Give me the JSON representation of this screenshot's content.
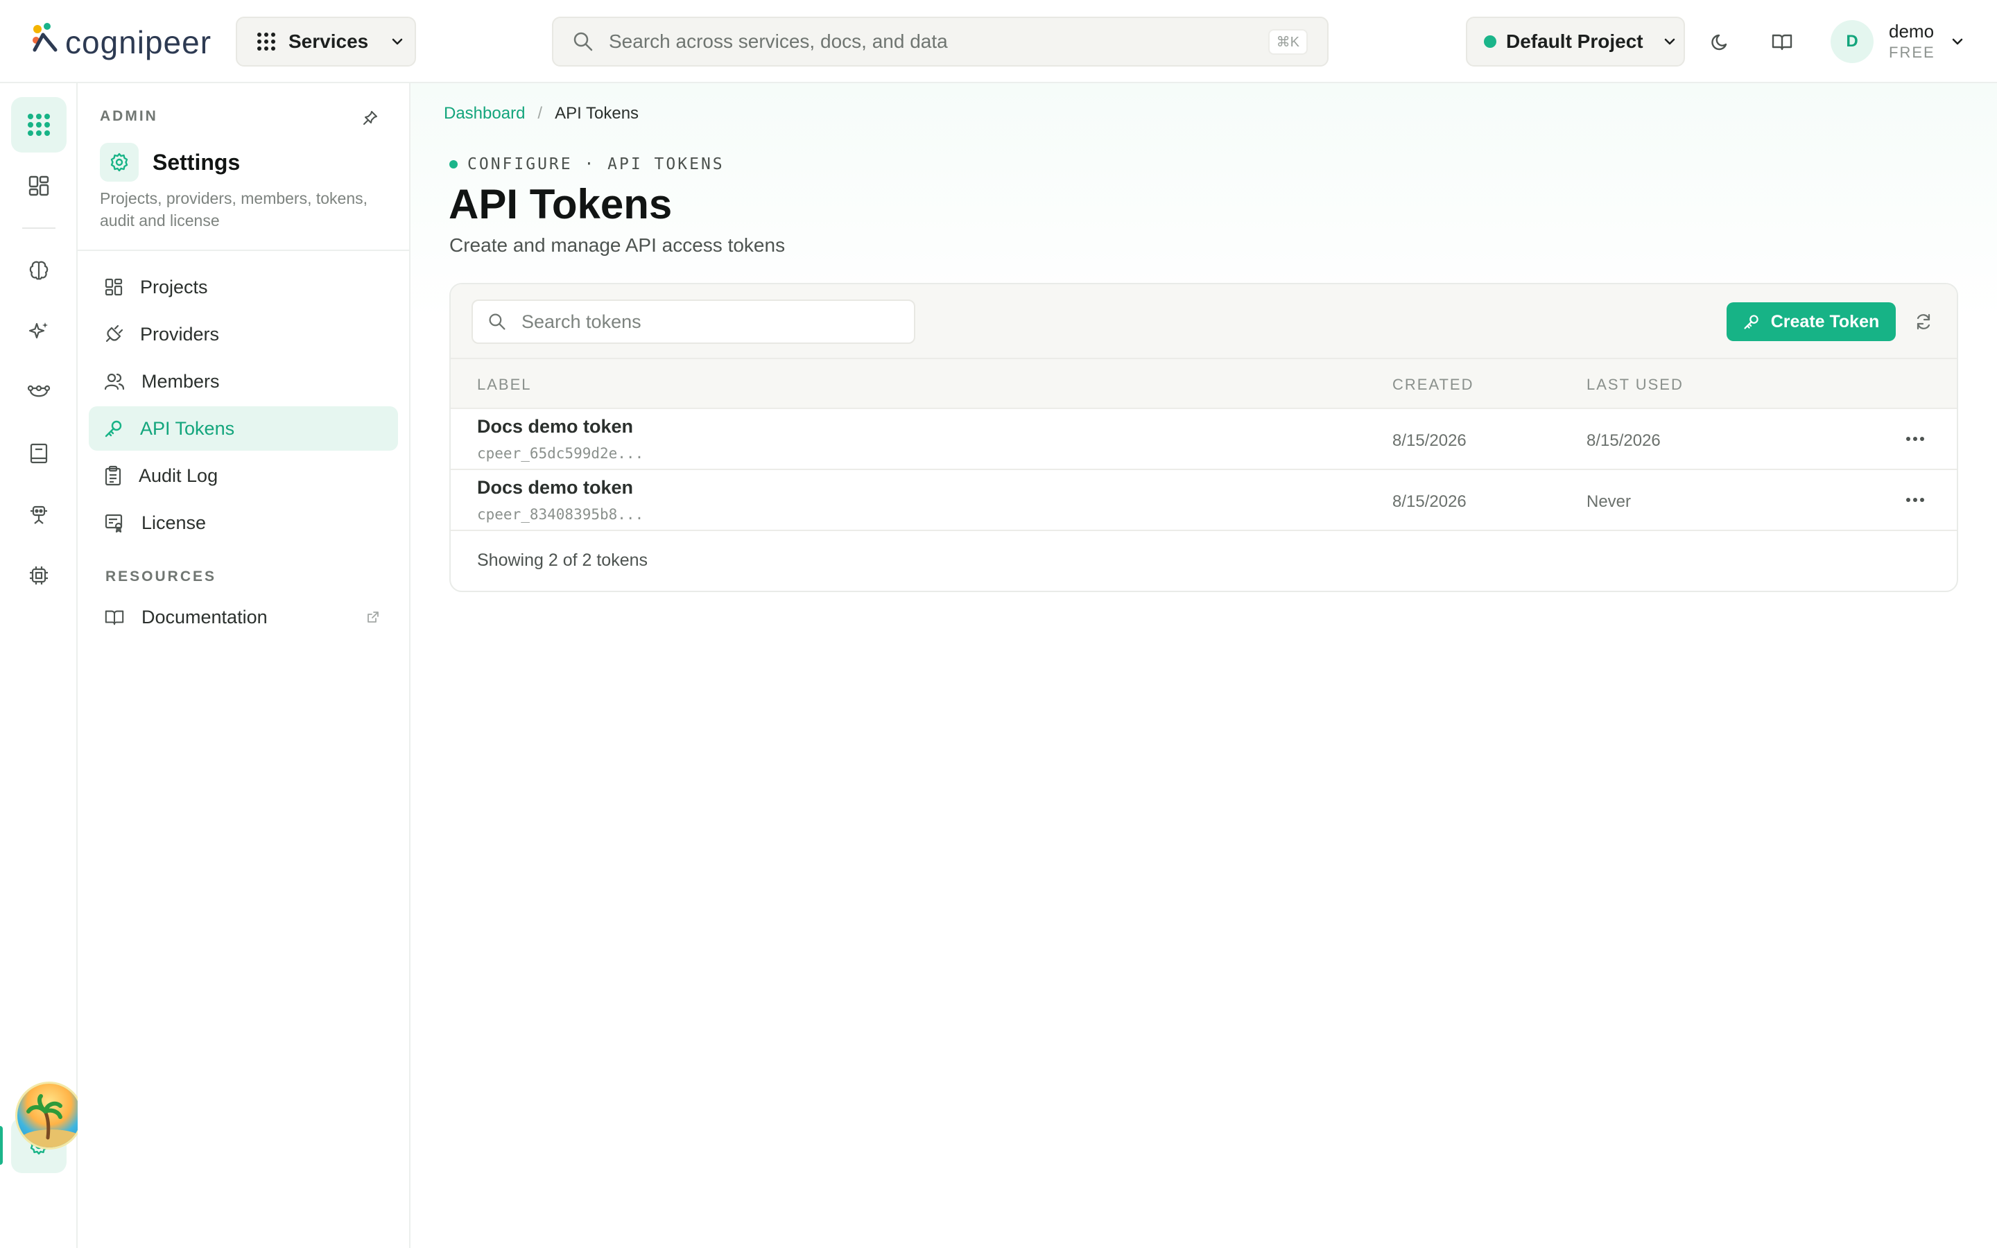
{
  "app": {
    "logo_text": "cognipeer",
    "services_label": "Services",
    "search_placeholder": "Search across services, docs, and data",
    "search_shortcut": "⌘K",
    "project_label": "Default Project",
    "user_initial": "D",
    "user_name": "demo",
    "user_plan": "FREE"
  },
  "rail": {
    "items": [
      "apps-grid-icon",
      "dashboard-icon",
      "brain-icon",
      "sparkles-icon",
      "flow-icon",
      "book-icon",
      "agent-icon",
      "chip-icon",
      "settings-icon"
    ]
  },
  "panel": {
    "section_label": "ADMIN",
    "title": "Settings",
    "description": "Projects, providers, members, tokens, audit and license",
    "nav": [
      {
        "label": "Projects",
        "icon": "projects-icon"
      },
      {
        "label": "Providers",
        "icon": "plug-icon"
      },
      {
        "label": "Members",
        "icon": "members-icon"
      },
      {
        "label": "API Tokens",
        "icon": "key-icon",
        "active": true
      },
      {
        "label": "Audit Log",
        "icon": "clipboard-icon"
      },
      {
        "label": "License",
        "icon": "license-icon"
      }
    ],
    "resources_label": "RESOURCES",
    "resources": [
      {
        "label": "Documentation",
        "icon": "book-open-icon"
      }
    ]
  },
  "main": {
    "breadcrumb": {
      "root": "Dashboard",
      "sep": "/",
      "current": "API Tokens"
    },
    "eyebrow": "CONFIGURE · API TOKENS",
    "title": "API Tokens",
    "subtitle": "Create and manage API access tokens",
    "search_placeholder": "Search tokens",
    "create_button": "Create Token",
    "columns": {
      "label": "LABEL",
      "created": "CREATED",
      "last_used": "LAST USED"
    },
    "tokens": [
      {
        "label": "Docs demo token",
        "key": "cpeer_65dc599d2e...",
        "created": "8/15/2026",
        "last_used": "8/15/2026"
      },
      {
        "label": "Docs demo token",
        "key": "cpeer_83408395b8...",
        "created": "8/15/2026",
        "last_used": "Never"
      }
    ],
    "footer": "Showing 2 of 2 tokens"
  },
  "colors": {
    "accent": "#17b386",
    "accent_soft": "#e6f6f0",
    "text": "#1c1f1e",
    "muted": "#7d837f"
  }
}
